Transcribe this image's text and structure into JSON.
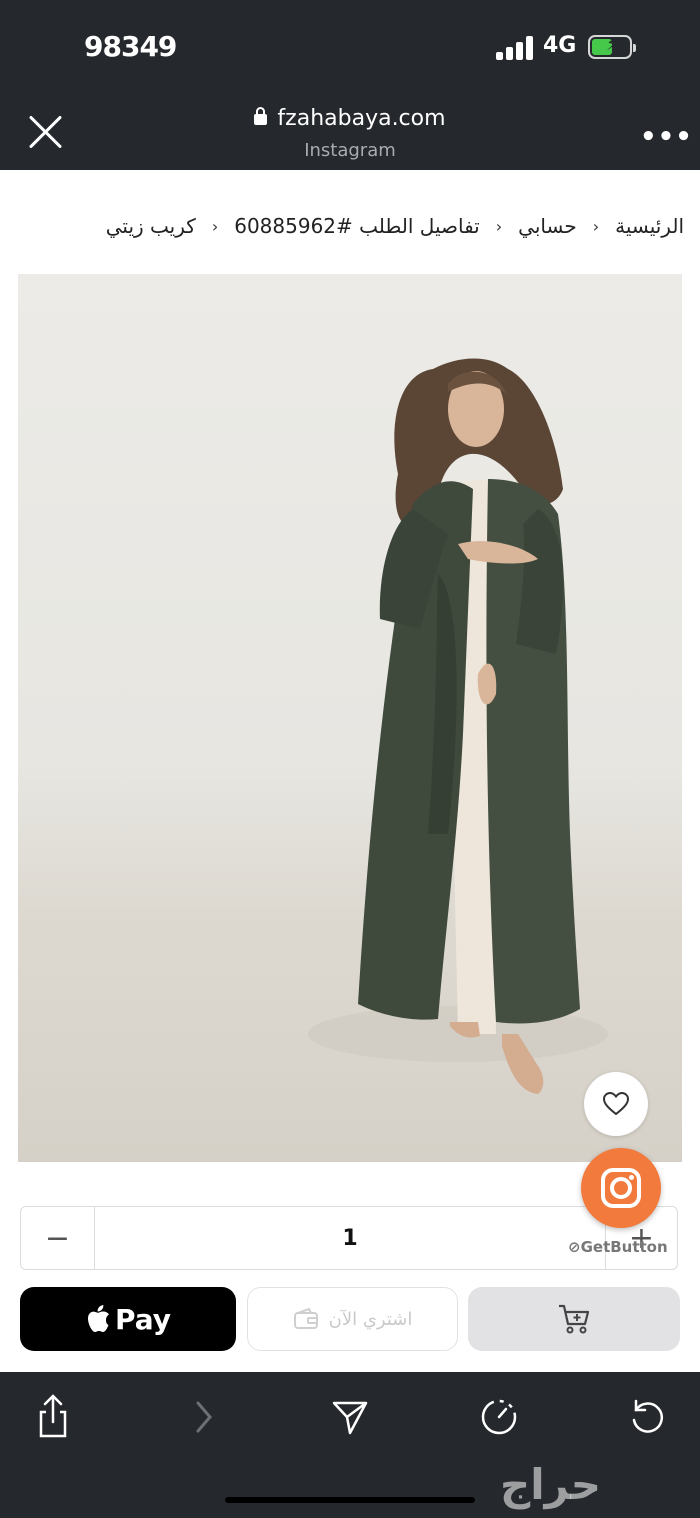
{
  "status_bar": {
    "time": "98349",
    "network": "4G"
  },
  "browser": {
    "domain": "fzahabaya.com",
    "subtitle": "Instagram"
  },
  "breadcrumb": [
    "الرئيسية",
    "حسابي",
    "تفاصيل الطلب #60885962",
    "كريب زيتي"
  ],
  "product": {
    "image_icon": "abaya-photo",
    "wishlist_icon": "heart-icon"
  },
  "quantity": {
    "value": "1",
    "minus": "−",
    "plus": "+"
  },
  "floating": {
    "getbutton_label": "GetButton"
  },
  "actions": {
    "apple_pay_label": "Pay",
    "buy_now_label": "اشتري الآن",
    "cart_icon": "cart-icon"
  },
  "watermark": "حراج",
  "colors": {
    "header_bg": "#25282d",
    "instagram": "#f27a3d",
    "cart_button": "#e2e1e3"
  }
}
